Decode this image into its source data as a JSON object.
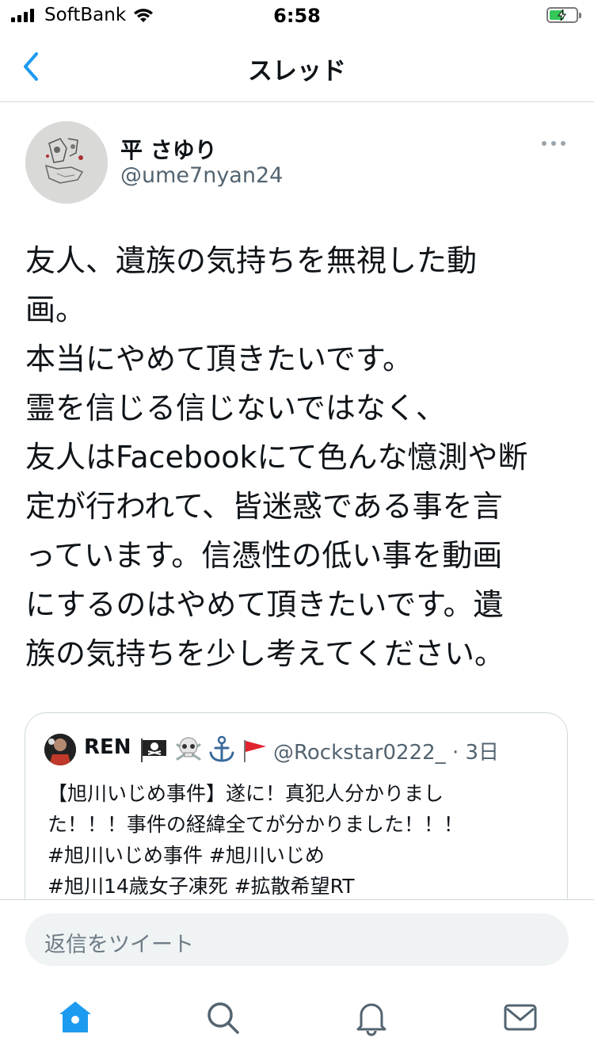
{
  "status_bar": {
    "carrier": "SoftBank",
    "time": "6:58"
  },
  "nav": {
    "title": "スレッド",
    "back_icon": "chevron-left-icon"
  },
  "author": {
    "display_name": "平 さゆり",
    "handle": "@ume7nyan24"
  },
  "tweet": {
    "lines": [
      "友人、遺族の気持ちを無視した動",
      "画。",
      "本当にやめて頂きたいです。",
      "霊を信じる信じないではなく、",
      "友人はFacebookにて色んな憶測や断",
      "定が行われて、皆迷惑である事を言",
      "っています。信憑性の低い事を動画",
      "にするのはやめて頂きたいです。遺",
      "族の気持ちを少し考えてください。"
    ]
  },
  "quote": {
    "name": "REN",
    "name_emoji": [
      "pirate-flag",
      "skull-crossbones",
      "anchor",
      "triangular-red-flag"
    ],
    "handle_time": "@Rockstar0222_ · 3日",
    "lines": [
      "【旭川いじめ事件】遂に！真犯人分かりまし",
      "た！！！事件の経緯全てが分かりました！！！",
      "#旭川いじめ事件 #旭川いじめ",
      "#旭川14歳女子凍死 #拡散希望RT"
    ]
  },
  "reply": {
    "placeholder": "返信をツイート"
  },
  "tabs": [
    {
      "name": "home",
      "icon": "home-icon",
      "active": true
    },
    {
      "name": "search",
      "icon": "search-icon"
    },
    {
      "name": "notifications",
      "icon": "bell-icon"
    },
    {
      "name": "messages",
      "icon": "envelope-icon"
    }
  ],
  "colors": {
    "accent": "#1d9bf0",
    "muted": "#536471",
    "border": "#cfd9de"
  }
}
